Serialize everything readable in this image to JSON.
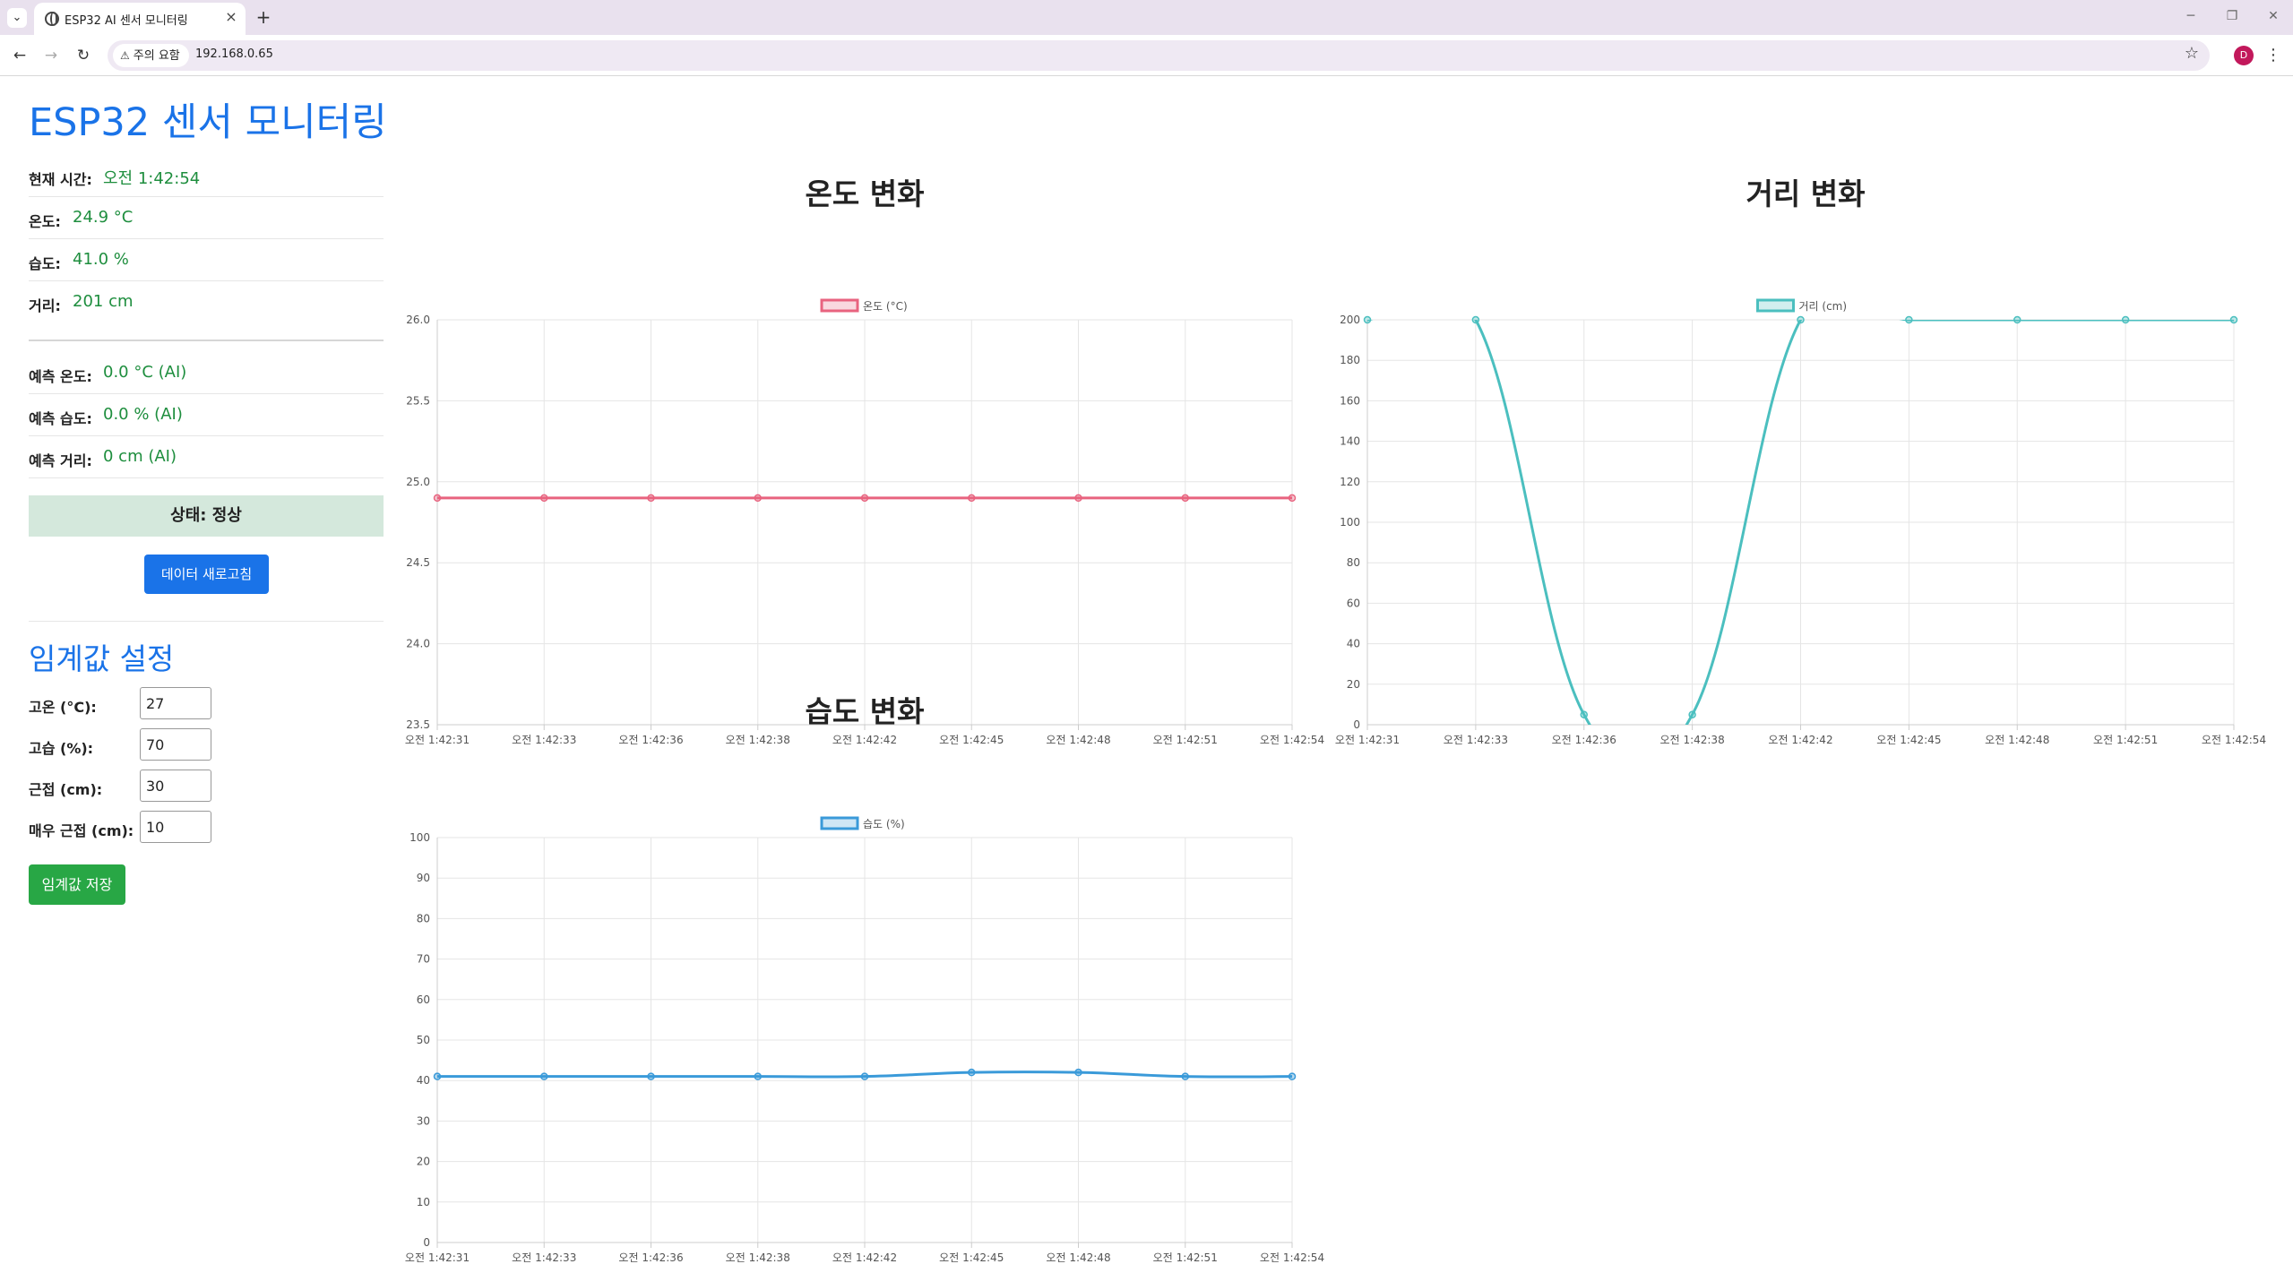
{
  "browser": {
    "tab_title": "ESP32 AI 센서 모니터링",
    "security_label": "주의 요함",
    "url": "192.168.0.65",
    "avatar_initial": "D"
  },
  "page": {
    "title": "ESP32 센서 모니터링",
    "readings": [
      {
        "label": "현재 시간:",
        "value": "오전 1:42:54"
      },
      {
        "label": "온도:",
        "value": "24.9 °C"
      },
      {
        "label": "습도:",
        "value": "41.0 %"
      },
      {
        "label": "거리:",
        "value": "201 cm"
      }
    ],
    "predictions": [
      {
        "label": "예측 온도:",
        "value": "0.0 °C (AI)"
      },
      {
        "label": "예측 습도:",
        "value": "0.0 % (AI)"
      },
      {
        "label": "예측 거리:",
        "value": "0 cm (AI)"
      }
    ],
    "status": "상태: 정상",
    "refresh_label": "데이터 새로고침",
    "threshold_title": "임계값 설정",
    "thresholds": [
      {
        "label": "고온 (°C):",
        "value": "27"
      },
      {
        "label": "고습 (%):",
        "value": "70"
      },
      {
        "label": "근접 (cm):",
        "value": "30"
      },
      {
        "label": "매우 근접 (cm):",
        "value": "10"
      }
    ],
    "save_label": "임계값 저장"
  },
  "colors": {
    "temperature": "#e8637f",
    "distance": "#4bbfbf",
    "humidity": "#3a9ad9",
    "accent": "#1a73e8",
    "ok_green": "#1e8e3e"
  },
  "chart_data": [
    {
      "type": "line",
      "title": "온도 변화",
      "x": [
        "오전 1:42:31",
        "오전 1:42:33",
        "오전 1:42:36",
        "오전 1:42:38",
        "오전 1:42:42",
        "오전 1:42:45",
        "오전 1:42:48",
        "오전 1:42:51",
        "오전 1:42:54"
      ],
      "series": [
        {
          "name": "온도 (°C)",
          "values": [
            24.9,
            24.9,
            24.9,
            24.9,
            24.9,
            24.9,
            24.9,
            24.9,
            24.9
          ]
        }
      ],
      "yticks": [
        "26.0",
        "25.5",
        "25.0",
        "24.5",
        "24.0",
        "23.5"
      ],
      "ylim": [
        23.5,
        26.0
      ],
      "grid": true,
      "legend": "top-center"
    },
    {
      "type": "line",
      "title": "거리 변화",
      "x": [
        "오전 1:42:31",
        "오전 1:42:33",
        "오전 1:42:36",
        "오전 1:42:38",
        "오전 1:42:42",
        "오전 1:42:45",
        "오전 1:42:48",
        "오전 1:42:51",
        "오전 1:42:54"
      ],
      "series": [
        {
          "name": "거리 (cm)",
          "values": [
            200,
            200,
            5,
            5,
            200,
            200,
            200,
            200,
            200
          ]
        }
      ],
      "yticks": [
        "200",
        "180",
        "160",
        "140",
        "120",
        "100",
        "80",
        "60",
        "40",
        "20",
        "0"
      ],
      "ylim": [
        0,
        200
      ],
      "grid": true,
      "legend": "top-center"
    },
    {
      "type": "line",
      "title": "습도 변화",
      "x": [
        "오전 1:42:31",
        "오전 1:42:33",
        "오전 1:42:36",
        "오전 1:42:38",
        "오전 1:42:42",
        "오전 1:42:45",
        "오전 1:42:48",
        "오전 1:42:51",
        "오전 1:42:54"
      ],
      "series": [
        {
          "name": "습도 (%)",
          "values": [
            41,
            41,
            41,
            41,
            41,
            42,
            42,
            41,
            41
          ]
        }
      ],
      "yticks": [
        "100",
        "90",
        "80",
        "70",
        "60",
        "50",
        "40",
        "30",
        "20",
        "10",
        "0"
      ],
      "ylim": [
        0,
        100
      ],
      "grid": true,
      "legend": "top-center"
    }
  ]
}
